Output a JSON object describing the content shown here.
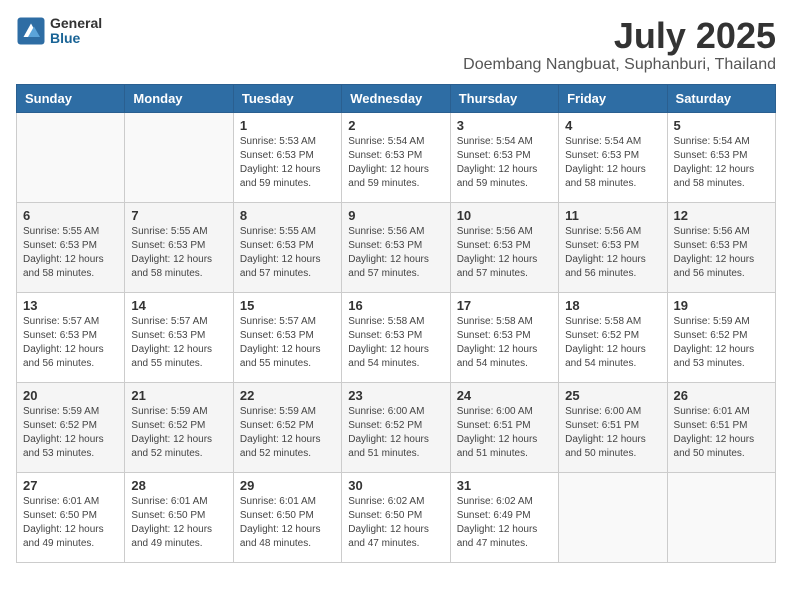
{
  "header": {
    "logo_general": "General",
    "logo_blue": "Blue",
    "month_title": "July 2025",
    "location": "Doembang Nangbuat, Suphanburi, Thailand"
  },
  "days_of_week": [
    "Sunday",
    "Monday",
    "Tuesday",
    "Wednesday",
    "Thursday",
    "Friday",
    "Saturday"
  ],
  "weeks": [
    [
      {
        "day": "",
        "info": ""
      },
      {
        "day": "",
        "info": ""
      },
      {
        "day": "1",
        "info": "Sunrise: 5:53 AM\nSunset: 6:53 PM\nDaylight: 12 hours\nand 59 minutes."
      },
      {
        "day": "2",
        "info": "Sunrise: 5:54 AM\nSunset: 6:53 PM\nDaylight: 12 hours\nand 59 minutes."
      },
      {
        "day": "3",
        "info": "Sunrise: 5:54 AM\nSunset: 6:53 PM\nDaylight: 12 hours\nand 59 minutes."
      },
      {
        "day": "4",
        "info": "Sunrise: 5:54 AM\nSunset: 6:53 PM\nDaylight: 12 hours\nand 58 minutes."
      },
      {
        "day": "5",
        "info": "Sunrise: 5:54 AM\nSunset: 6:53 PM\nDaylight: 12 hours\nand 58 minutes."
      }
    ],
    [
      {
        "day": "6",
        "info": "Sunrise: 5:55 AM\nSunset: 6:53 PM\nDaylight: 12 hours\nand 58 minutes."
      },
      {
        "day": "7",
        "info": "Sunrise: 5:55 AM\nSunset: 6:53 PM\nDaylight: 12 hours\nand 58 minutes."
      },
      {
        "day": "8",
        "info": "Sunrise: 5:55 AM\nSunset: 6:53 PM\nDaylight: 12 hours\nand 57 minutes."
      },
      {
        "day": "9",
        "info": "Sunrise: 5:56 AM\nSunset: 6:53 PM\nDaylight: 12 hours\nand 57 minutes."
      },
      {
        "day": "10",
        "info": "Sunrise: 5:56 AM\nSunset: 6:53 PM\nDaylight: 12 hours\nand 57 minutes."
      },
      {
        "day": "11",
        "info": "Sunrise: 5:56 AM\nSunset: 6:53 PM\nDaylight: 12 hours\nand 56 minutes."
      },
      {
        "day": "12",
        "info": "Sunrise: 5:56 AM\nSunset: 6:53 PM\nDaylight: 12 hours\nand 56 minutes."
      }
    ],
    [
      {
        "day": "13",
        "info": "Sunrise: 5:57 AM\nSunset: 6:53 PM\nDaylight: 12 hours\nand 56 minutes."
      },
      {
        "day": "14",
        "info": "Sunrise: 5:57 AM\nSunset: 6:53 PM\nDaylight: 12 hours\nand 55 minutes."
      },
      {
        "day": "15",
        "info": "Sunrise: 5:57 AM\nSunset: 6:53 PM\nDaylight: 12 hours\nand 55 minutes."
      },
      {
        "day": "16",
        "info": "Sunrise: 5:58 AM\nSunset: 6:53 PM\nDaylight: 12 hours\nand 54 minutes."
      },
      {
        "day": "17",
        "info": "Sunrise: 5:58 AM\nSunset: 6:53 PM\nDaylight: 12 hours\nand 54 minutes."
      },
      {
        "day": "18",
        "info": "Sunrise: 5:58 AM\nSunset: 6:52 PM\nDaylight: 12 hours\nand 54 minutes."
      },
      {
        "day": "19",
        "info": "Sunrise: 5:59 AM\nSunset: 6:52 PM\nDaylight: 12 hours\nand 53 minutes."
      }
    ],
    [
      {
        "day": "20",
        "info": "Sunrise: 5:59 AM\nSunset: 6:52 PM\nDaylight: 12 hours\nand 53 minutes."
      },
      {
        "day": "21",
        "info": "Sunrise: 5:59 AM\nSunset: 6:52 PM\nDaylight: 12 hours\nand 52 minutes."
      },
      {
        "day": "22",
        "info": "Sunrise: 5:59 AM\nSunset: 6:52 PM\nDaylight: 12 hours\nand 52 minutes."
      },
      {
        "day": "23",
        "info": "Sunrise: 6:00 AM\nSunset: 6:52 PM\nDaylight: 12 hours\nand 51 minutes."
      },
      {
        "day": "24",
        "info": "Sunrise: 6:00 AM\nSunset: 6:51 PM\nDaylight: 12 hours\nand 51 minutes."
      },
      {
        "day": "25",
        "info": "Sunrise: 6:00 AM\nSunset: 6:51 PM\nDaylight: 12 hours\nand 50 minutes."
      },
      {
        "day": "26",
        "info": "Sunrise: 6:01 AM\nSunset: 6:51 PM\nDaylight: 12 hours\nand 50 minutes."
      }
    ],
    [
      {
        "day": "27",
        "info": "Sunrise: 6:01 AM\nSunset: 6:50 PM\nDaylight: 12 hours\nand 49 minutes."
      },
      {
        "day": "28",
        "info": "Sunrise: 6:01 AM\nSunset: 6:50 PM\nDaylight: 12 hours\nand 49 minutes."
      },
      {
        "day": "29",
        "info": "Sunrise: 6:01 AM\nSunset: 6:50 PM\nDaylight: 12 hours\nand 48 minutes."
      },
      {
        "day": "30",
        "info": "Sunrise: 6:02 AM\nSunset: 6:50 PM\nDaylight: 12 hours\nand 47 minutes."
      },
      {
        "day": "31",
        "info": "Sunrise: 6:02 AM\nSunset: 6:49 PM\nDaylight: 12 hours\nand 47 minutes."
      },
      {
        "day": "",
        "info": ""
      },
      {
        "day": "",
        "info": ""
      }
    ]
  ]
}
